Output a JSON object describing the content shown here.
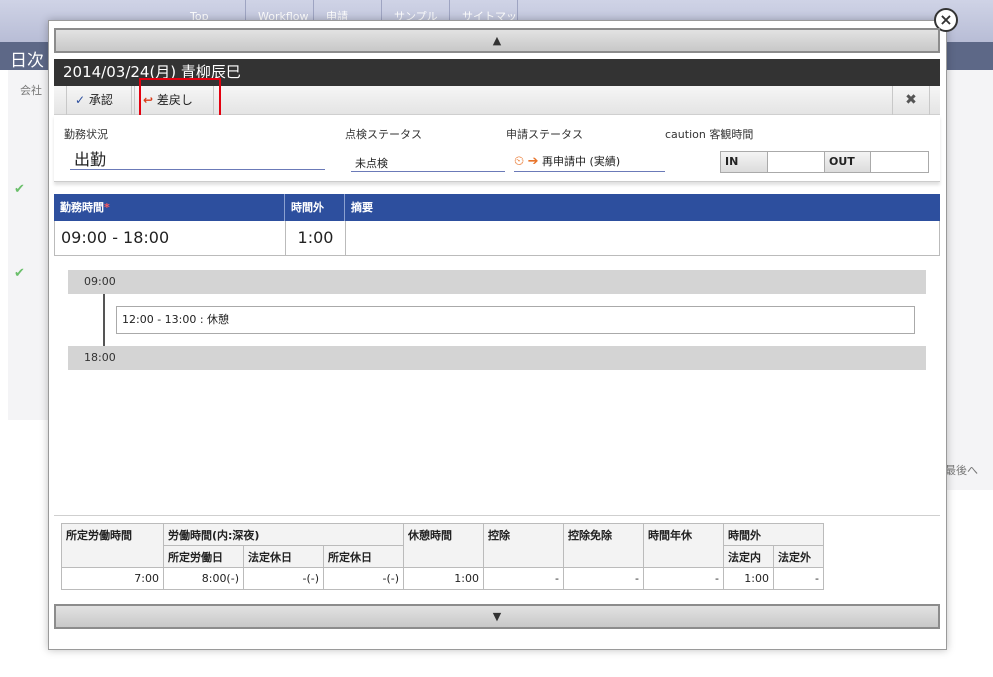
{
  "background": {
    "nav": [
      "Top",
      "Workflow",
      "申請",
      "サンプル",
      "サイトマップ"
    ],
    "page_title": "日次",
    "label_company": "会社",
    "label_first": "最後へ"
  },
  "modal": {
    "scroll_up": "▲",
    "scroll_down": "▼",
    "title": "2014/03/24(月)  青柳辰巳",
    "toolbar": {
      "approve_label": "承認",
      "sendback_label": "差戻し",
      "close_label": "✖"
    },
    "info": {
      "work_status_label": "勤務状況",
      "work_status_value": "出勤",
      "check_status_label": "点検ステータス",
      "check_status_value": "未点検",
      "apply_status_label": "申請ステータス",
      "apply_status_value": "再申請中 (実績)",
      "objective_label": "caution 客観時間",
      "in_label": "IN",
      "in_value": "",
      "out_label": "OUT",
      "out_value": ""
    },
    "work_table": {
      "headers": [
        "勤務時間",
        "時間外",
        "摘要"
      ],
      "required_mark": "*",
      "work_time": "09:00  -  18:00",
      "overtime": "1:00",
      "summary": ""
    },
    "timeline": {
      "start": "09:00",
      "break": "12:00 - 13:00 : 休憩",
      "end": "18:00"
    },
    "summary_table": {
      "h_scheduled": "所定労働時間",
      "h_labor": "労働時間(内:深夜)",
      "h_labor_sub": [
        "所定労働日",
        "法定休日",
        "所定休日"
      ],
      "h_break": "休憩時間",
      "h_deduct": "控除",
      "h_deduct_exempt": "控除免除",
      "h_hourly_leave": "時間年休",
      "h_overtime": "時間外",
      "h_overtime_sub": [
        "法定内",
        "法定外"
      ],
      "values": [
        "7:00",
        "8:00(-)",
        "-(-)",
        "-(-)",
        "1:00",
        "-",
        "-",
        "-",
        "1:00",
        "-"
      ]
    }
  },
  "colors": {
    "header_blue": "#2d4f9e",
    "title_dark": "#333333",
    "highlight_red": "#e3000f",
    "accent_orange": "#e8742a"
  }
}
